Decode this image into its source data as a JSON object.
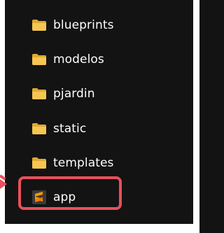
{
  "explorer": {
    "items": [
      {
        "label": "blueprints",
        "icon": "folder-icon",
        "color": "#f0c24e"
      },
      {
        "label": "modelos",
        "icon": "folder-icon",
        "color": "#f0c24e"
      },
      {
        "label": "pjardin",
        "icon": "folder-icon",
        "color": "#f0c24e"
      },
      {
        "label": "static",
        "icon": "folder-icon",
        "color": "#f0c24e"
      },
      {
        "label": "templates",
        "icon": "folder-icon",
        "color": "#f0c24e"
      },
      {
        "label": "app",
        "icon": "sublime-file-icon",
        "color": "#ff9800"
      }
    ],
    "highlight_color": "#e8505b"
  }
}
